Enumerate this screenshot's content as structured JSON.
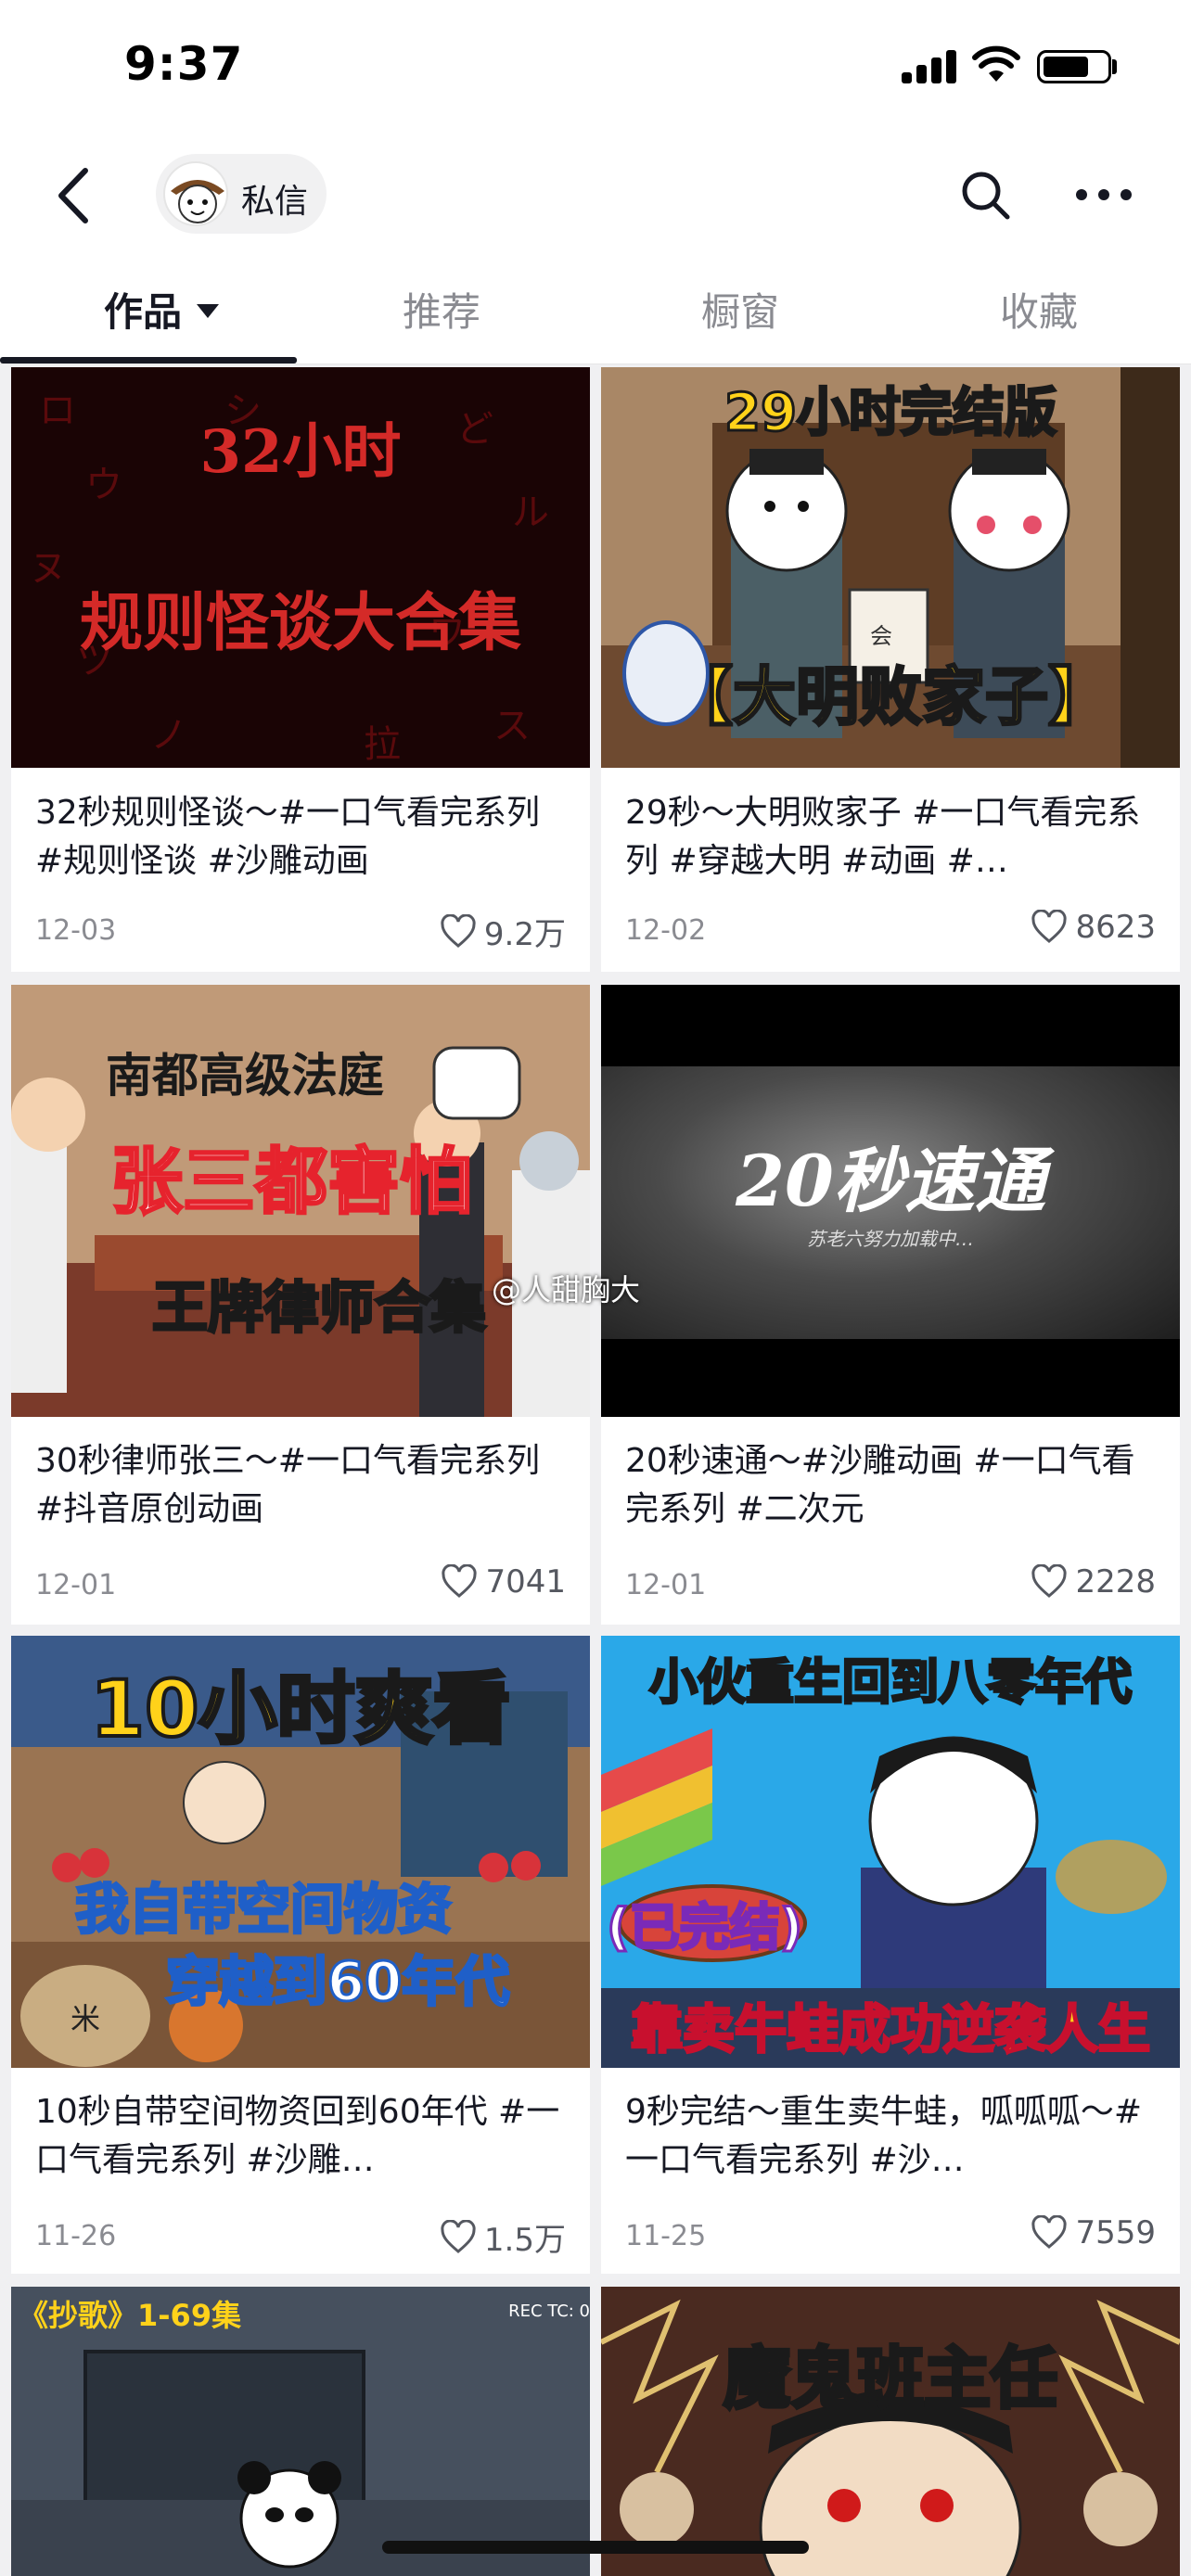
{
  "status": {
    "time": "9:37"
  },
  "nav": {
    "dm_label": "私信"
  },
  "tabs": [
    {
      "label": "作品"
    },
    {
      "label": "推荐"
    },
    {
      "label": "橱窗"
    },
    {
      "label": "收藏"
    }
  ],
  "videos": [
    {
      "title": "32秒规则怪谈～#一口气看完系列  #规则怪谈  #沙雕动画",
      "date": "12-03",
      "likes": "9.2万",
      "thumb_text_1": "32小时",
      "thumb_text_2": "规则怪谈大合集"
    },
    {
      "title": "29秒～大明败家子 #一口气看完系列  #穿越大明  #动画  #…",
      "date": "12-02",
      "likes": "8623",
      "thumb_text_1": "29小时完结版",
      "thumb_text_2": "【大明败家子】",
      "thumb_small": "会"
    },
    {
      "title": "30秒律师张三～#一口气看完系列  #抖音原创动画",
      "date": "12-01",
      "likes": "7041",
      "thumb_text_1": "南都高级法庭",
      "thumb_text_2": "张三都害怕",
      "thumb_text_3": "王牌律师合集"
    },
    {
      "title": "20秒速通～#沙雕动画  #一口气看完系列 #二次元",
      "date": "12-01",
      "likes": "2228",
      "thumb_text_1": "20秒速通",
      "thumb_text_2": "苏老六努力加载中…"
    },
    {
      "title": "10秒自带空间物资回到60年代 #一口气看完系列 #沙雕…",
      "date": "11-26",
      "likes": "1.5万",
      "thumb_text_1": "10小时爽看",
      "thumb_text_2": "我自带空间物资",
      "thumb_text_3": "穿越到60年代",
      "thumb_small": "米"
    },
    {
      "title": "9秒完结～重生卖牛蛙，呱呱呱～#一口气看完系列 #沙…",
      "date": "11-25",
      "likes": "7559",
      "thumb_text_1": "小伙重生回到八零年代",
      "thumb_text_2": "(已完结)",
      "thumb_text_3": "靠卖牛蛙成功逆袭人生"
    },
    {
      "thumb_text_1": "《抄歌》1-69集",
      "thumb_text_2": "REC TC: 0"
    },
    {
      "thumb_text_1": "魔鬼班主任"
    }
  ],
  "watermark": "@人甜胸大",
  "colors": {
    "accent_red": "#e6232d",
    "gold": "#ffd21a"
  }
}
